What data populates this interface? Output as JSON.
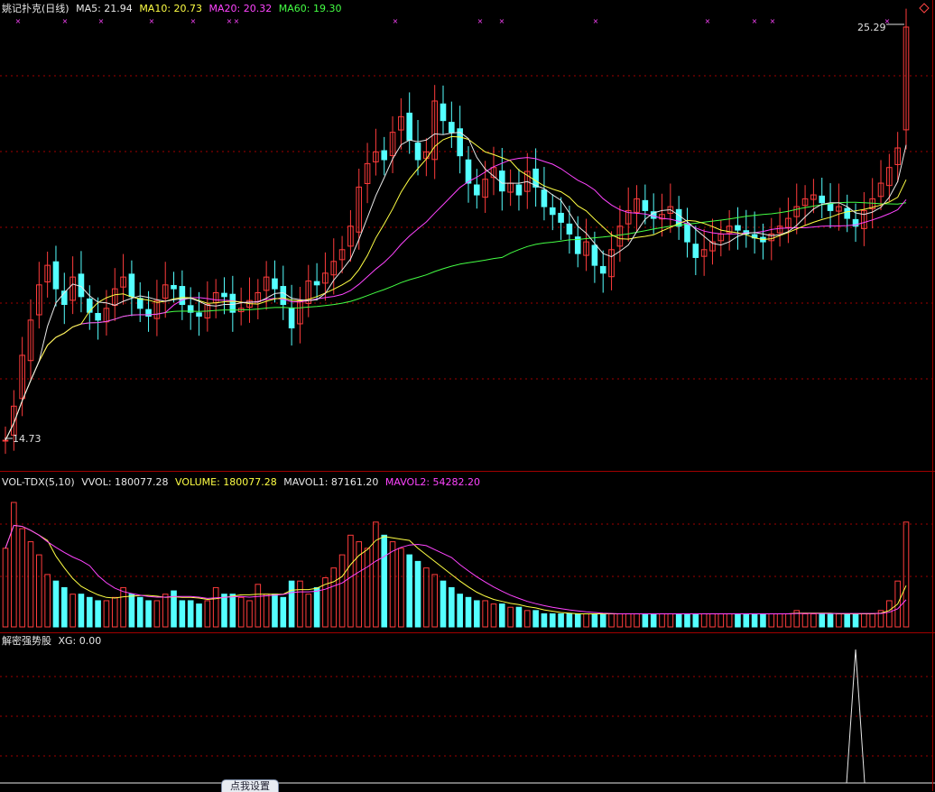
{
  "price_panel": {
    "legend": {
      "stock_name": "姚记扑克(日线)",
      "ma5": "MA5: 21.94",
      "ma10": "MA10: 20.73",
      "ma20": "MA20: 20.32",
      "ma60": "MA60: 19.30"
    },
    "high_label": "25.29",
    "low_label": "14.73",
    "colors": {
      "up": "#ff3c3c",
      "down": "#54ffff",
      "ma5": "#e8e8e8",
      "ma10": "#ffff44",
      "ma20": "#ff44ff",
      "ma60": "#44ff44",
      "grid": "#a00000"
    }
  },
  "volume_panel": {
    "legend": {
      "name": "VOL-TDX(5,10)",
      "vvol": "VVOL: 180077.28",
      "volume": "VOLUME: 180077.28",
      "mavol1": "MAVOL1: 87161.20",
      "mavol2": "MAVOL2: 54282.20"
    }
  },
  "indicator_panel": {
    "legend": {
      "name": "解密强势股",
      "xg": "XG: 0.00"
    }
  },
  "settings_button_label": "点我设置",
  "chart_data": {
    "type": "candlestick",
    "title": "姚记扑克(日线)",
    "price_range": [
      14.73,
      25.29
    ],
    "close": [
      14.73,
      15.6,
      16.9,
      17.8,
      18.7,
      19.2,
      18.6,
      18.2,
      18.9,
      18.4,
      18.0,
      17.8,
      18.1,
      18.6,
      18.9,
      18.4,
      18.1,
      17.9,
      18.3,
      18.7,
      18.6,
      18.2,
      18.0,
      17.9,
      18.2,
      18.5,
      18.4,
      18.0,
      18.1,
      18.3,
      18.5,
      18.9,
      18.6,
      18.2,
      17.6,
      18.3,
      18.8,
      18.7,
      19.0,
      19.3,
      19.6,
      20.2,
      21.2,
      21.8,
      22.1,
      21.9,
      22.6,
      23.0,
      22.4,
      21.9,
      22.1,
      23.4,
      22.9,
      22.6,
      22.0,
      21.3,
      21.0,
      21.4,
      21.7,
      21.1,
      21.3,
      21.0,
      21.6,
      21.2,
      20.7,
      20.5,
      20.3,
      20.0,
      19.5,
      19.8,
      19.2,
      19.0,
      19.6,
      20.2,
      20.6,
      20.9,
      20.6,
      20.4,
      20.5,
      20.7,
      20.2,
      19.8,
      19.4,
      19.6,
      19.8,
      20.0,
      20.2,
      20.1,
      20.0,
      19.9,
      19.8,
      20.0,
      20.2,
      20.4,
      20.7,
      20.9,
      21.0,
      20.8,
      20.6,
      20.7,
      20.4,
      20.2,
      20.6,
      20.9,
      21.3,
      21.7,
      22.2,
      25.29
    ],
    "volume": [
      24,
      38,
      30,
      26,
      22,
      16,
      14,
      12,
      10,
      10,
      9,
      8,
      8,
      9,
      12,
      10,
      9,
      8,
      8,
      10,
      11,
      8,
      8,
      7,
      8,
      12,
      10,
      10,
      9,
      8,
      13,
      10,
      10,
      9,
      14,
      14,
      10,
      12,
      15,
      18,
      22,
      28,
      26,
      24,
      32,
      28,
      26,
      24,
      22,
      20,
      18,
      16,
      14,
      12,
      10,
      9,
      8,
      8,
      7,
      7,
      6,
      6,
      5,
      5,
      4,
      4,
      4,
      4,
      4,
      4,
      4,
      4,
      4,
      4,
      4,
      4,
      4,
      4,
      4,
      4,
      4,
      4,
      4,
      4,
      4,
      4,
      4,
      4,
      4,
      4,
      4,
      4,
      4,
      4,
      5,
      4,
      4,
      4,
      4,
      4,
      4,
      4,
      4,
      4,
      5,
      8,
      14,
      32
    ],
    "xg_signal_index": 101
  }
}
